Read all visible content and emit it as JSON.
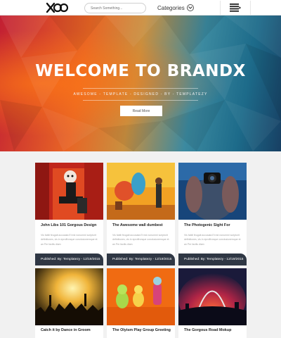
{
  "header": {
    "logo_text": "XO",
    "search_placeholder": "Search Something...",
    "categories_label": "Categories",
    "menu_icon": "hamburger-menu-icon"
  },
  "hero": {
    "title": "WELCOME TO BRANDX",
    "subtitle": "AWESOME - TEMPLATE - DESIGNED - BY - TEMPLATEZY",
    "button_label": "Read More"
  },
  "cards": [
    {
      "title": "John Libs 101 Gorgous Design",
      "description": "Vis fabili feugait accusata Et est nonummi scriptorit definitiones, vis in eproffronque conclusionemque et an Per facilis diam",
      "footer": "Published: By: Templatezy - 12/19/2015",
      "image": "performer-in-mask-red-curtain"
    },
    {
      "title": "The Awesome wall dumbest",
      "description": "Vis fabili feugait accusata Et est nonummi scriptorit definitiones, vis in eproffronque conclusionemque et an Per facilis diam",
      "footer": "Published: By: Templatezy - 12/19/2015",
      "image": "man-in-front-of-graffiti-wall"
    },
    {
      "title": "The Photogenic Sight For",
      "description": "Vis fabili feugait accusata Et est nonummi scriptorit definitiones, vis in eproffronque conclusionemque et an Per facilis diam",
      "footer": "Published: By: Templatezy - 12/19/2015",
      "image": "tattooed-photographer-with-camera"
    },
    {
      "title": "Catch it by Dance in Groom",
      "image": "concert-crowd-stage-lights"
    },
    {
      "title": "The Olyism Play Group Greeting",
      "image": "toy-figurines-on-orange"
    },
    {
      "title": "The Gorgous Road Mokup",
      "image": "city-arch-fisheye-sunset"
    }
  ],
  "colors": {
    "card_footer": "#2f3744",
    "page_background": "#f1f1f1",
    "hero_orange": "#e86525",
    "hero_teal": "#3c8aa0"
  }
}
